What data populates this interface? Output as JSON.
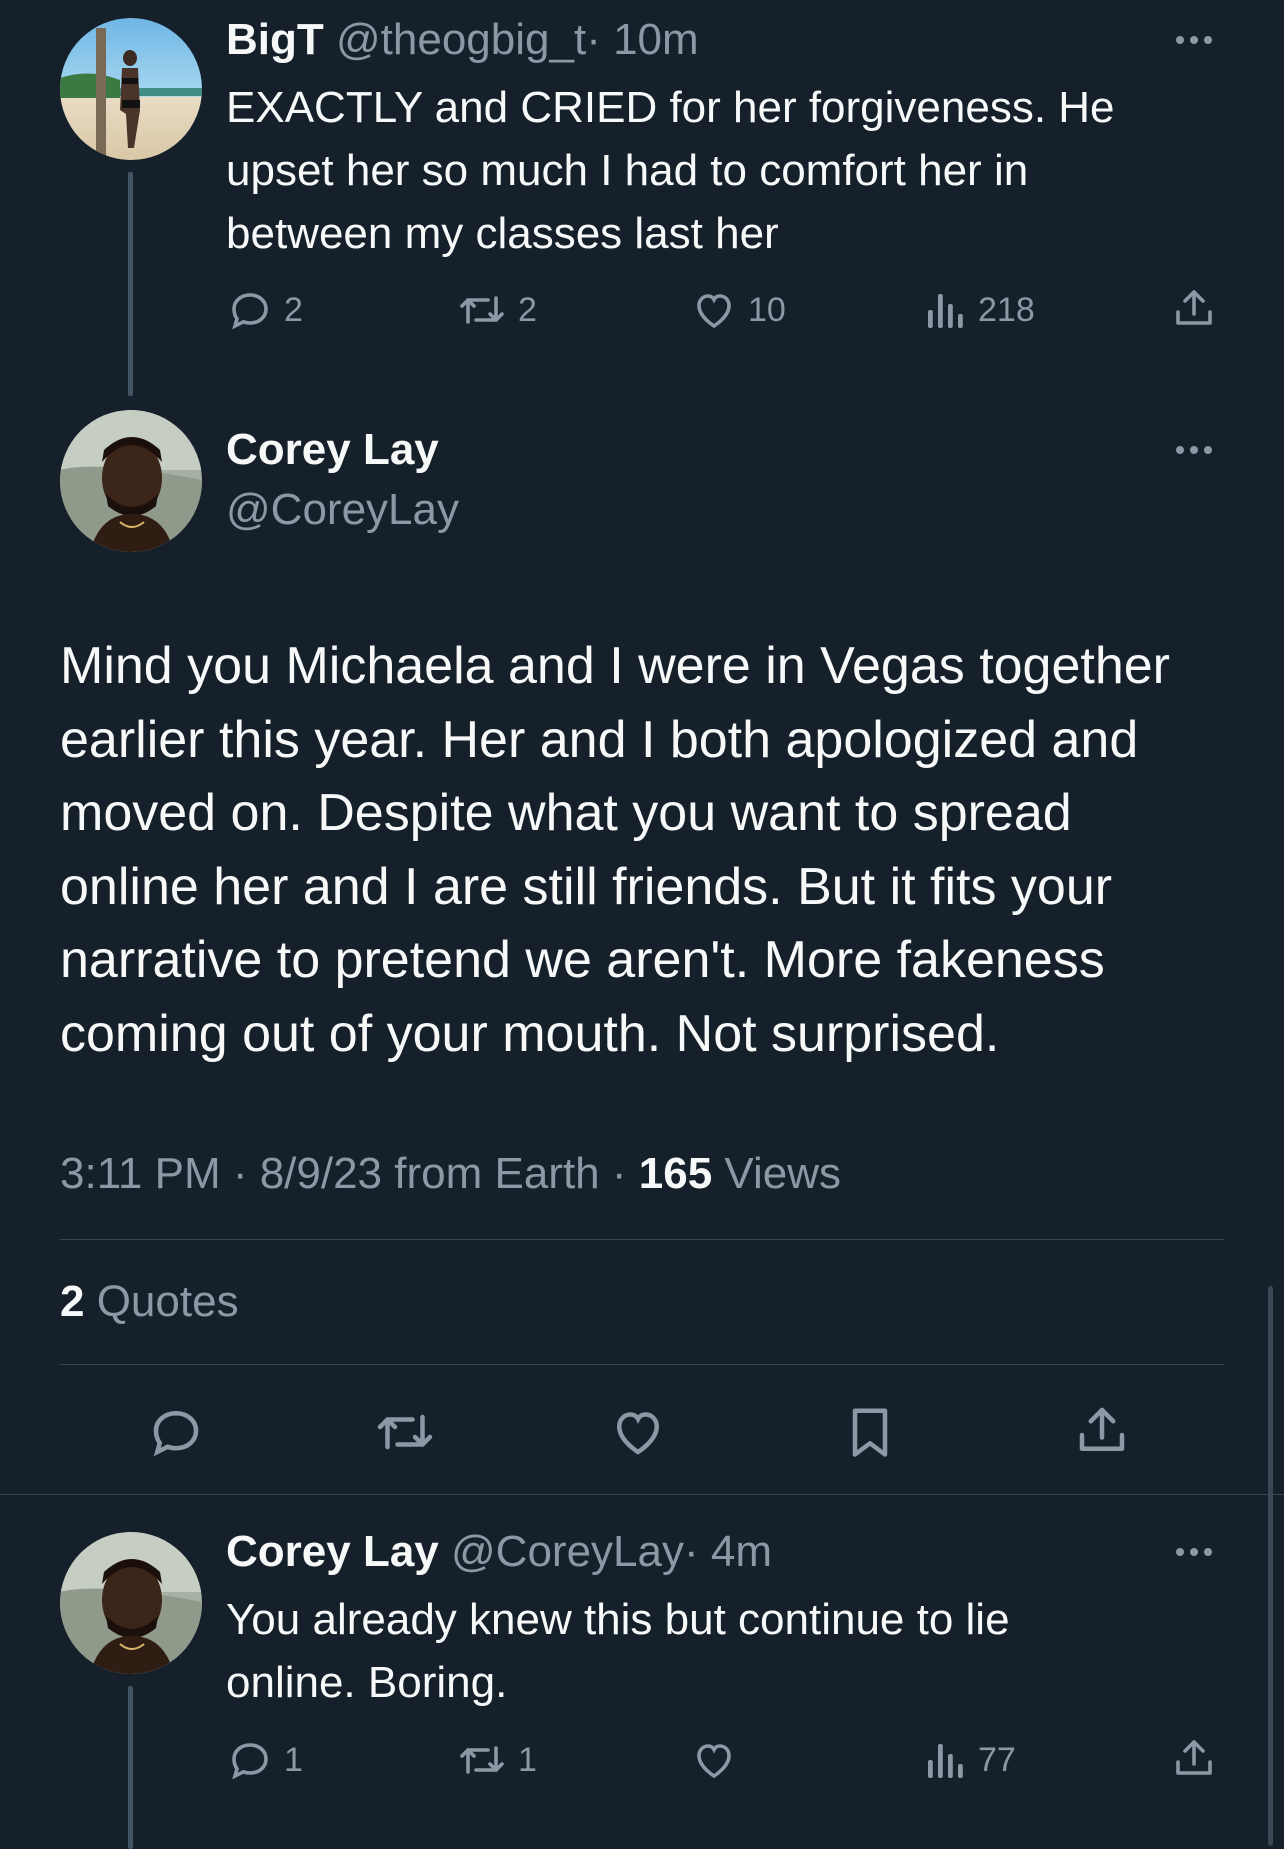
{
  "parent_tweet": {
    "display_name": "BigT",
    "handle": "@theogbig_t",
    "time": "· 10m",
    "text_lines": [
      "EXACTLY and CRIED for her forgiveness. He",
      "upset her so much I had to comfort her in",
      "between my classes last her"
    ],
    "replies": "2",
    "retweets": "2",
    "likes": "10",
    "views": "218"
  },
  "main_tweet": {
    "display_name": "Corey Lay",
    "handle": "@CoreyLay",
    "text_lines": [
      "Mind you Michaela and I were in Vegas together",
      "earlier this year. Her and I both apologized and",
      "moved on. Despite what you want to spread",
      "online her and I are still friends. But it fits your",
      "narrative to pretend we aren't. More fakeness",
      "coming out of your mouth. Not surprised."
    ],
    "meta_time": "3:11 PM · 8/9/23 from Earth · ",
    "views_count": "165",
    "views_label": " Views",
    "quotes_count": "2",
    "quotes_label": " Quotes"
  },
  "reply_tweet": {
    "display_name": "Corey Lay",
    "handle": "@CoreyLay",
    "time": "· 4m",
    "text_lines": [
      "You already knew this but continue to lie",
      "online. Boring."
    ],
    "replies": "1",
    "retweets": "1",
    "likes": "",
    "views": "77"
  },
  "icons": {
    "reply": "reply-icon",
    "retweet": "retweet-icon",
    "like": "heart-icon",
    "views": "views-icon",
    "share": "share-icon",
    "bookmark": "bookmark-icon",
    "more": "more-icon"
  },
  "colors": {
    "background": "#15202b",
    "text": "#f7f9f9",
    "muted": "#8b98a5",
    "divider": "#38444d"
  }
}
